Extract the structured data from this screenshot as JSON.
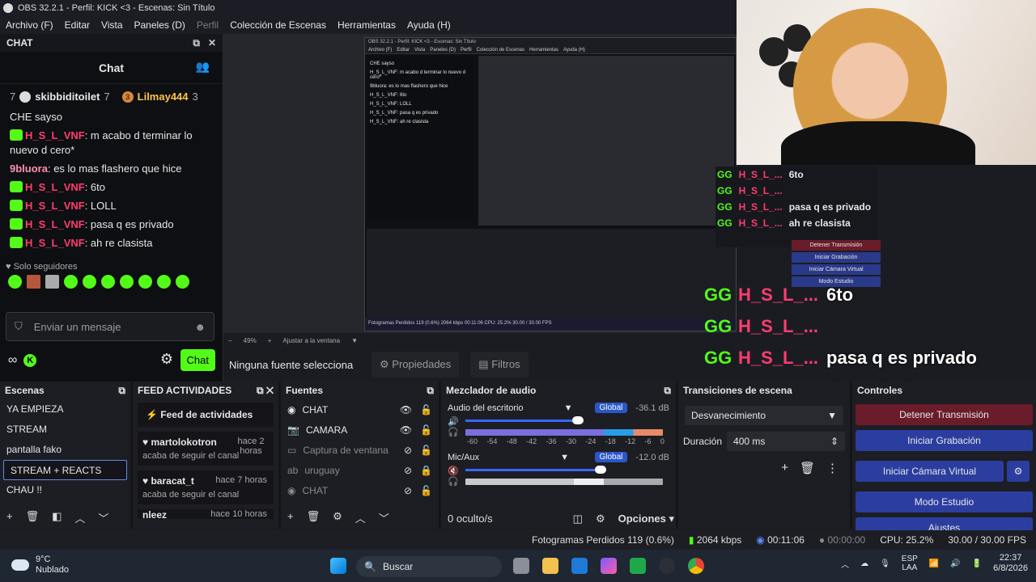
{
  "window": {
    "title": "OBS 32.2.1 - Perfil: KICK <3 - Escenas: Sin Título"
  },
  "menu": [
    {
      "label": "Archivo (F)",
      "enabled": true
    },
    {
      "label": "Editar",
      "enabled": true
    },
    {
      "label": "Vista",
      "enabled": true
    },
    {
      "label": "Paneles (D)",
      "enabled": true
    },
    {
      "label": "Perfil",
      "enabled": false
    },
    {
      "label": "Colección de Escenas",
      "enabled": true
    },
    {
      "label": "Herramientas",
      "enabled": true
    },
    {
      "label": "Ayuda (H)",
      "enabled": true
    }
  ],
  "chat": {
    "dock_title": "CHAT",
    "title": "Chat",
    "top_badges": [
      {
        "num": "7",
        "user": "skibbiditoilet",
        "count": "7"
      },
      {
        "num": "3",
        "user": "Lilmay444",
        "count": "3"
      }
    ],
    "messages": [
      {
        "user": "",
        "text": "CHE sayso"
      },
      {
        "user": "H_S_L_VNF",
        "text": ": m acabo d terminar lo nuevo d cero*"
      },
      {
        "user": "9bluora",
        "text": ": es lo mas flashero que hice"
      },
      {
        "user": "H_S_L_VNF",
        "text": ": 6to"
      },
      {
        "user": "H_S_L_VNF",
        "text": ": LOLL"
      },
      {
        "user": "H_S_L_VNF",
        "text": ": pasa q es privado"
      },
      {
        "user": "H_S_L_VNF",
        "text": ": ah re clasista"
      }
    ],
    "followers_only": "Solo seguidores",
    "input_placeholder": "Enviar un mensaje",
    "send_label": "Chat"
  },
  "preview": {
    "zoom": "49%",
    "fit_label": "Ajustar a la ventana",
    "no_source": "Ninguna fuente selecciona",
    "props_label": "Propiedades",
    "filters_label": "Filtros",
    "overlay": [
      {
        "badge": "GG",
        "user": "H_S_L_...",
        "text": "6to"
      },
      {
        "badge": "GG",
        "user": "H_S_L_...",
        "text": ""
      },
      {
        "badge": "GG",
        "user": "H_S_L_...",
        "text": "pasa q es privado"
      },
      {
        "badge": "GG",
        "user": "H_S_L_...",
        "text": "ah re clasista"
      }
    ],
    "mini": {
      "title": "OBS 32.2.1 - Perfil: KICK <3 - Escenas: Sin Título",
      "menu": [
        "Archivo (F)",
        "Editar",
        "Vista",
        "Paneles (D)",
        "Perfil",
        "Colección de Escenas",
        "Herramientas",
        "Ayuda (H)"
      ],
      "chat_lines": [
        "CHE sayso",
        "H_S_L_VNF: m acabo d terminar lo nuevo d cero*",
        "9bluora: es lo mas flashero que hice",
        "H_S_L_VNF: 6to",
        "H_S_L_VNF: LOLL",
        "H_S_L_VNF: pasa q es privado",
        "H_S_L_VNF: ah re clasista"
      ],
      "bar": "Fotogramas Perdidos 119 (0.6%)   2064 kbps   00:11:06   CPU: 25.2%   30.00 / 30.00 FPS"
    }
  },
  "docks": {
    "scenes": {
      "title": "Escenas",
      "items": [
        "YA EMPIEZA",
        "STREAM",
        "pantalla fako",
        "STREAM + REACTS",
        "CHAU !!"
      ],
      "selected": 3
    },
    "feed": {
      "title": "FEED ACTIVIDADES",
      "header": "Feed de actividades",
      "items": [
        {
          "user": "martolokotron",
          "time": "hace 2 horas",
          "action": "acaba de seguir el canal"
        },
        {
          "user": "baracat_t",
          "time": "hace 7 horas",
          "action": "acaba de seguir el canal"
        },
        {
          "user": "nleez",
          "time": "hace 10 horas",
          "action": ""
        }
      ]
    },
    "sources": {
      "title": "Fuentes",
      "items": [
        {
          "name": "CHAT",
          "icon": "globe-icon",
          "visible": true,
          "locked": false,
          "dim": false
        },
        {
          "name": "CAMARA",
          "icon": "camera-icon",
          "visible": true,
          "locked": false,
          "dim": false
        },
        {
          "name": "Captura de ventana",
          "icon": "window-icon",
          "visible": false,
          "locked": false,
          "dim": true
        },
        {
          "name": "uruguay",
          "icon": "text-icon",
          "visible": false,
          "locked": true,
          "dim": true
        },
        {
          "name": "CHAT",
          "icon": "globe-icon",
          "visible": false,
          "locked": false,
          "dim": true
        }
      ]
    },
    "mixer": {
      "title": "Mezclador de audio",
      "channels": [
        {
          "name": "Audio del escritorio",
          "db": "-36.1 dB",
          "scope": "Global"
        },
        {
          "name": "Mic/Aux",
          "db": "-12.0 dB",
          "scope": "Global"
        }
      ],
      "ticks": [
        "-60",
        "-54",
        "-48",
        "-42",
        "-36",
        "-30",
        "-24",
        "-18",
        "-12",
        "-6",
        "0"
      ],
      "hidden": "0 oculto/s",
      "options": "Opciones"
    },
    "transitions": {
      "title": "Transiciones de escena",
      "type": "Desvanecimiento",
      "duration_label": "Duración",
      "duration": "400 ms"
    },
    "controls": {
      "title": "Controles",
      "buttons": [
        "Detener Transmisión",
        "Iniciar Grabación",
        "Iniciar Cámara Virtual",
        "Modo Estudio",
        "Ajustes"
      ]
    }
  },
  "status": {
    "dropped": "Fotogramas Perdidos 119 (0.6%)",
    "bitrate": "2064 kbps",
    "stream_time": "00:11:06",
    "rec_time": "00:00:00",
    "cpu": "CPU: 25.2%",
    "fps": "30.00 / 30.00 FPS"
  },
  "taskbar": {
    "temp": "9°C",
    "weather": "Nublado",
    "search": "Buscar",
    "lang1": "ESP",
    "lang2": "LAA",
    "time": "22:37",
    "date": "6/8/2026"
  }
}
